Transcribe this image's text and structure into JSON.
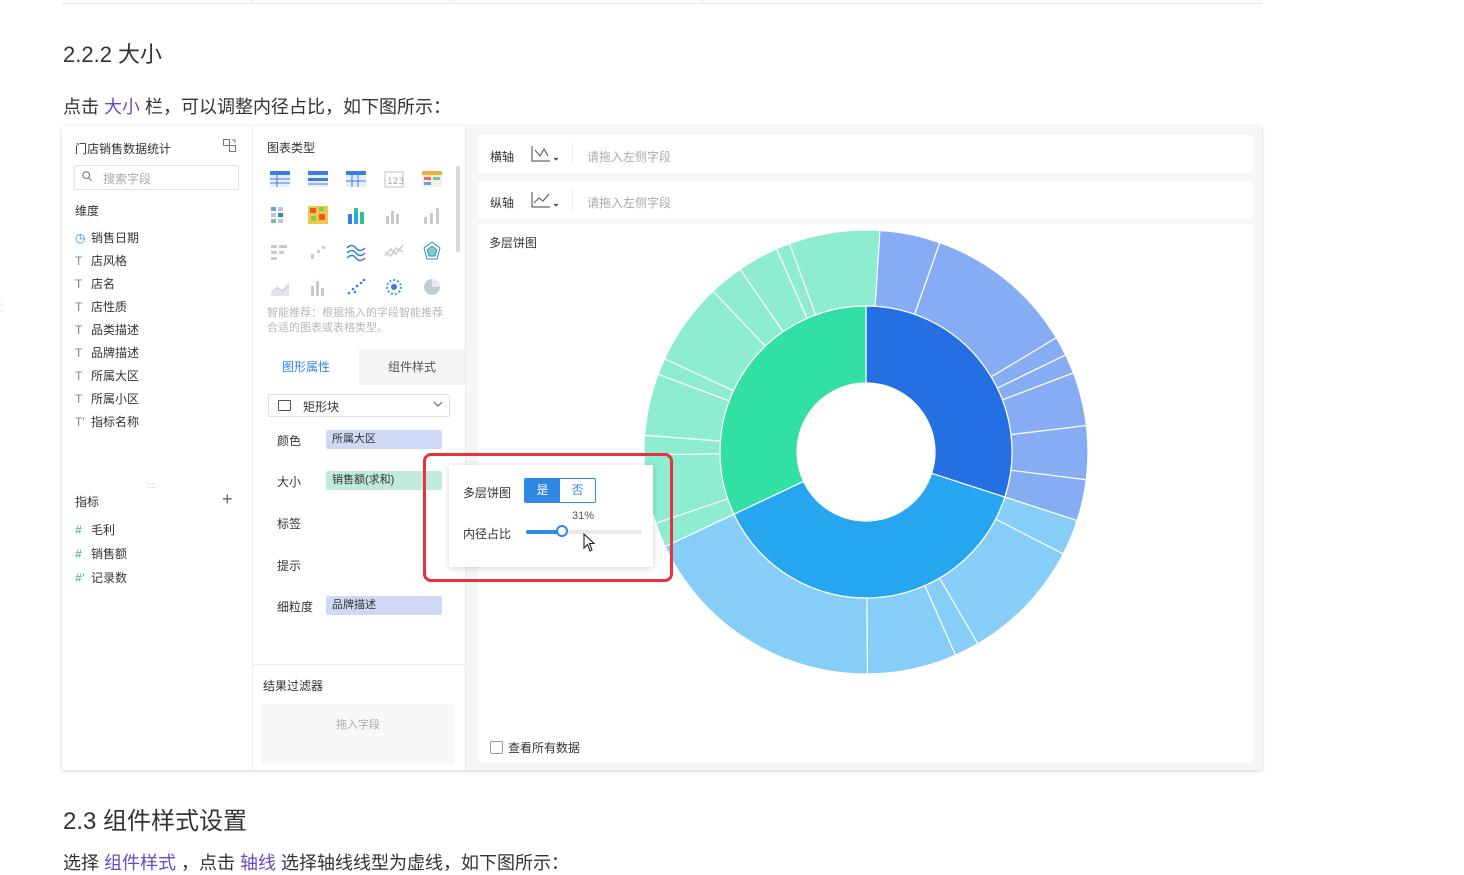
{
  "doc": {
    "heading_222": "2.2.2 大小",
    "para1_pre": "点击 ",
    "para1_link": "大小",
    "para1_post": " 栏，可以调整内径占比，如下图所示：",
    "heading_23": "2.3 组件样式设置",
    "para2_pre": "选择 ",
    "para2_link1": "组件样式",
    "para2_mid": " ，点击 ",
    "para2_link2": "轴线",
    "para2_post": " 选择轴线线型为虚线，如下图所示："
  },
  "fields": {
    "dataset_title": "门店销售数据统计",
    "search_placeholder": "搜索字段",
    "dimension_title": "维度",
    "dimensions": [
      {
        "icon": "clock-icon",
        "glyph": "◷",
        "label": "销售日期"
      },
      {
        "icon": "text-type-icon",
        "glyph": "T",
        "label": "店风格"
      },
      {
        "icon": "text-type-icon",
        "glyph": "T",
        "label": "店名"
      },
      {
        "icon": "text-type-icon",
        "glyph": "T",
        "label": "店性质"
      },
      {
        "icon": "text-type-icon",
        "glyph": "T",
        "label": "品类描述"
      },
      {
        "icon": "text-type-icon",
        "glyph": "T",
        "label": "品牌描述"
      },
      {
        "icon": "text-type-icon",
        "glyph": "T",
        "label": "所属大区"
      },
      {
        "icon": "text-type-icon",
        "glyph": "T",
        "label": "所属小区"
      },
      {
        "icon": "text-type-icon",
        "glyph": "T'",
        "label": "指标名称"
      }
    ],
    "measure_title": "指标",
    "measures": [
      {
        "icon": "hash-icon",
        "glyph": "#",
        "label": "毛利"
      },
      {
        "icon": "hash-icon",
        "glyph": "#",
        "label": "销售额"
      },
      {
        "icon": "hash-icon",
        "glyph": "#'",
        "label": "记录数"
      }
    ]
  },
  "middle": {
    "chart_type_title": "图表类型",
    "smart_hint": "智能推荐：根据拖入的字段智能推荐合适的图表或表格类型。",
    "tab_active": "图形属性",
    "tab_inactive": "组件样式",
    "shape_select": "矩形块",
    "props": [
      {
        "label": "颜色",
        "pill": "所属大区"
      },
      {
        "label": "大小",
        "pill": "销售额(求和)"
      },
      {
        "label": "标签",
        "pill": ""
      },
      {
        "label": "提示",
        "pill": ""
      },
      {
        "label": "细粒度",
        "pill": "品牌描述"
      }
    ],
    "result_filter_title": "结果过滤器",
    "drag_field": "拖入字段"
  },
  "axes": {
    "x_label": "横轴",
    "y_label": "纵轴",
    "placeholder": "请拖入左侧字段"
  },
  "canvas": {
    "chart_title": "多层饼图",
    "see_all": "查看所有数据"
  },
  "popup": {
    "multi_label": "多层饼图",
    "yes": "是",
    "no": "否",
    "inner_label": "内径占比",
    "percent_text": "31%",
    "inner_ratio": 0.31
  },
  "colors": {
    "accent": "#2f87e6",
    "highlight": "#e8323e",
    "link": "#6a4bc4"
  },
  "chart_data": {
    "type": "pie",
    "title": "多层饼图",
    "inner_radius_ratio": 0.31,
    "inner_ring": [
      {
        "color": "#2470e3",
        "share": 0.3
      },
      {
        "color": "#27a6f0",
        "share": 0.38
      },
      {
        "color": "#33e0a3",
        "share": 0.32
      }
    ],
    "outer_ring": [
      {
        "color": "#86acf3",
        "share": 0.054
      },
      {
        "color": "#86acf3",
        "share": 0.11
      },
      {
        "color": "#86acf3",
        "share": 0.014
      },
      {
        "color": "#86acf3",
        "share": 0.014
      },
      {
        "color": "#86acf3",
        "share": 0.039
      },
      {
        "color": "#86acf3",
        "share": 0.039
      },
      {
        "color": "#86acf3",
        "share": 0.03
      },
      {
        "color": "#86cdf7",
        "share": 0.026
      },
      {
        "color": "#86cdf7",
        "share": 0.09
      },
      {
        "color": "#86cdf7",
        "share": 0.018
      },
      {
        "color": "#86cdf7",
        "share": 0.065
      },
      {
        "color": "#86cdf7",
        "share": 0.181
      },
      {
        "color": "#8eecd0",
        "share": 0.018
      },
      {
        "color": "#8eecd0",
        "share": 0.05
      },
      {
        "color": "#8eecd0",
        "share": 0.014
      },
      {
        "color": "#8eecd0",
        "share": 0.045
      },
      {
        "color": "#8eecd0",
        "share": 0.012
      },
      {
        "color": "#8eecd0",
        "share": 0.06
      },
      {
        "color": "#8eecd0",
        "share": 0.025
      },
      {
        "color": "#8eecd0",
        "share": 0.03
      },
      {
        "color": "#8eecd0",
        "share": 0.01
      },
      {
        "color": "#8eecd0",
        "share": 0.066
      }
    ]
  }
}
